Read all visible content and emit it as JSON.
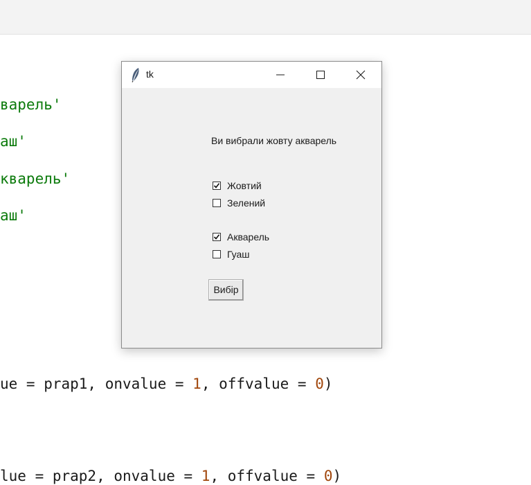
{
  "editor": {
    "lines": [
      {
        "id": "l1",
        "parts": [
          {
            "t": "str",
            "v": "варель'"
          }
        ]
      },
      {
        "id": "l2",
        "parts": [
          {
            "t": "str",
            "v": "аш'"
          }
        ]
      },
      {
        "id": "l3",
        "parts": [
          {
            "t": "str",
            "v": "кварель'"
          }
        ]
      },
      {
        "id": "l4",
        "parts": [
          {
            "t": "str",
            "v": "аш'"
          }
        ]
      },
      {
        "id": "l5",
        "parts": [
          {
            "t": "plain",
            "v": "ue = prap1, onvalue = "
          },
          {
            "t": "num",
            "v": "1"
          },
          {
            "t": "plain",
            "v": ", offvalue = "
          },
          {
            "t": "num",
            "v": "0"
          },
          {
            "t": "plain",
            "v": ")"
          }
        ]
      },
      {
        "id": "l6",
        "parts": [
          {
            "t": "plain",
            "v": "lue = prap2, onvalue = "
          },
          {
            "t": "num",
            "v": "1"
          },
          {
            "t": "plain",
            "v": ", offvalue = "
          },
          {
            "t": "num",
            "v": "0"
          },
          {
            "t": "plain",
            "v": ")"
          }
        ]
      }
    ]
  },
  "tk_window": {
    "title": "tk",
    "app_icon": "feather-icon",
    "controls": {
      "minimize": "minimize-icon",
      "maximize": "maximize-icon",
      "close": "close-icon"
    },
    "status_text": "Ви вибрали жовту акварель",
    "checkboxes": {
      "yellow": {
        "label": "Жовтий",
        "checked": true
      },
      "green": {
        "label": "Зелений",
        "checked": false
      },
      "watercolor": {
        "label": "Акварель",
        "checked": true
      },
      "gouache": {
        "label": "Гуаш",
        "checked": false
      }
    },
    "button_label": "Вибір"
  }
}
